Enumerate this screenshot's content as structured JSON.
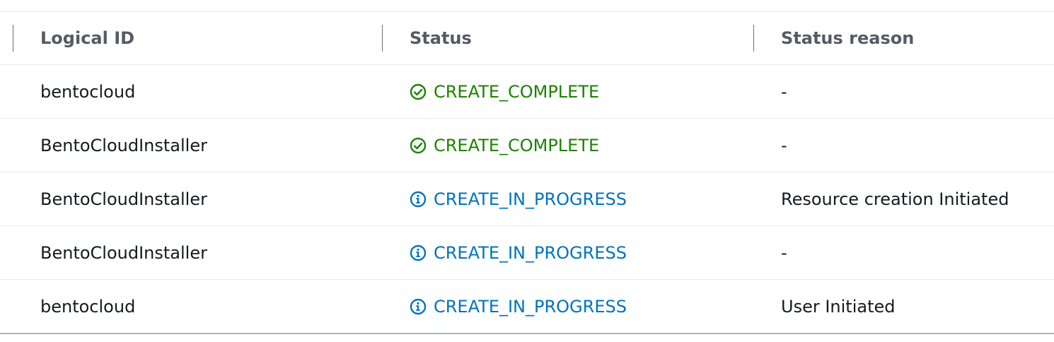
{
  "table": {
    "headers": {
      "logical_id": "Logical ID",
      "status": "Status",
      "status_reason": "Status reason"
    },
    "rows": [
      {
        "logical_id": "bentocloud",
        "status": "CREATE_COMPLETE",
        "status_type": "success",
        "status_icon": "check-circle-icon",
        "status_reason": "-"
      },
      {
        "logical_id": "BentoCloudInstaller",
        "status": "CREATE_COMPLETE",
        "status_type": "success",
        "status_icon": "check-circle-icon",
        "status_reason": "-"
      },
      {
        "logical_id": "BentoCloudInstaller",
        "status": "CREATE_IN_PROGRESS",
        "status_type": "info",
        "status_icon": "info-circle-icon",
        "status_reason": "Resource creation Initiated"
      },
      {
        "logical_id": "BentoCloudInstaller",
        "status": "CREATE_IN_PROGRESS",
        "status_type": "info",
        "status_icon": "info-circle-icon",
        "status_reason": "-"
      },
      {
        "logical_id": "bentocloud",
        "status": "CREATE_IN_PROGRESS",
        "status_type": "info",
        "status_icon": "info-circle-icon",
        "status_reason": "User Initiated"
      }
    ]
  },
  "colors": {
    "success": "#1d8102",
    "info": "#0073bb",
    "header_text": "#545b64",
    "body_text": "#16191f"
  }
}
